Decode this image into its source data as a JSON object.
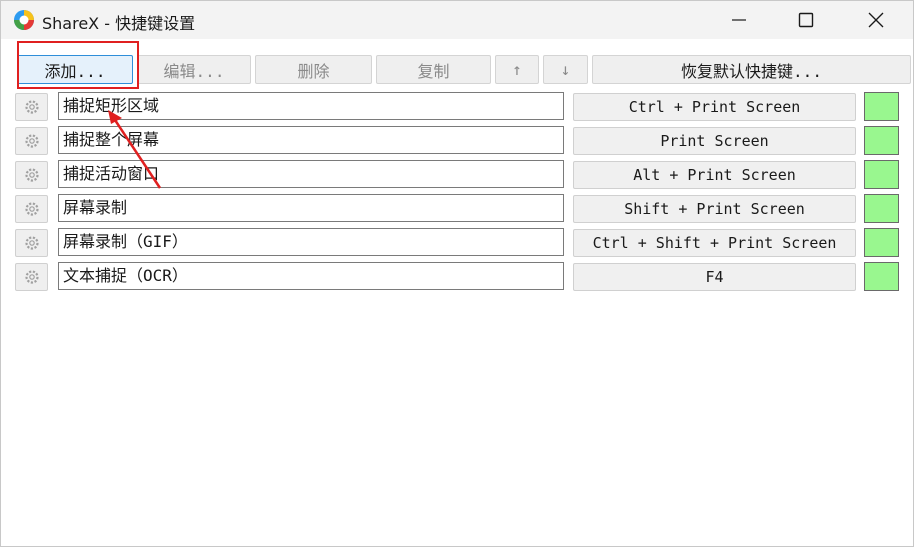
{
  "window": {
    "title": "ShareX - 快捷键设置",
    "icon": "sharex-logo-icon",
    "controls": [
      "minimize-icon",
      "maximize-icon",
      "close-icon"
    ]
  },
  "toolbar": {
    "add_label": "添加...",
    "edit_label": "编辑...",
    "delete_label": "删除",
    "copy_label": "复制",
    "move_up_label": "↑",
    "move_down_label": "↓",
    "restore_label": "恢复默认快捷键..."
  },
  "hotkeys": [
    {
      "name": "捕捉矩形区域",
      "hotkey": "Ctrl + Print Screen"
    },
    {
      "name": "捕捉整个屏幕",
      "hotkey": "Print Screen"
    },
    {
      "name": "捕捉活动窗口",
      "hotkey": "Alt + Print Screen"
    },
    {
      "name": "屏幕录制",
      "hotkey": "Shift + Print Screen"
    },
    {
      "name": "屏幕录制（GIF）",
      "hotkey": "Ctrl + Shift + Print Screen"
    },
    {
      "name": "文本捕捉（OCR）",
      "hotkey": "F4"
    }
  ],
  "colors": {
    "status_ok": "#99f78f",
    "annotation": "#e02020",
    "add_button_border": "#2f8ed9"
  }
}
